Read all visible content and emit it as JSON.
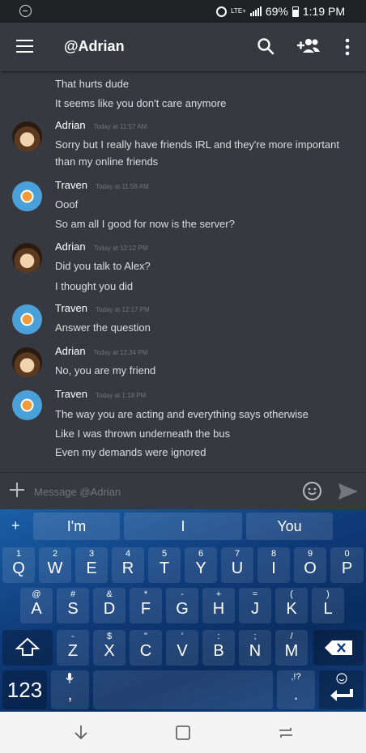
{
  "status_bar": {
    "network": "LTE+",
    "battery": "69%",
    "time": "1:19 PM"
  },
  "app_bar": {
    "title": "@Adrian",
    "icons": [
      "menu-icon",
      "search-icon",
      "add-friend-icon",
      "more-icon"
    ]
  },
  "messages": {
    "lines_top": [
      "That hurts dude",
      "It seems like you don't care anymore"
    ],
    "groups": [
      {
        "author": "Adrian",
        "timestamp": "Today at 11:57 AM",
        "lines": [
          "Sorry but I really have friends IRL and they're more important",
          "than my online friends"
        ]
      },
      {
        "author": "Traven",
        "timestamp": "Today at 11:58 AM",
        "lines": [
          "Ooof",
          "So am all I good for now is the server?"
        ]
      },
      {
        "author": "Adrian",
        "timestamp": "Today at 12:12 PM",
        "lines": [
          "Did you talk to Alex?",
          "I thought you did"
        ]
      },
      {
        "author": "Traven",
        "timestamp": "Today at 12:17 PM",
        "lines": [
          "Answer the question"
        ]
      },
      {
        "author": "Adrian",
        "timestamp": "Today at 12:34 PM",
        "lines": [
          "No, you are my friend"
        ]
      },
      {
        "author": "Traven",
        "timestamp": "Today at 1:18 PM",
        "lines": [
          "The way you are acting and everything says otherwise",
          "Like I was thrown underneath the bus",
          "Even my demands were ignored"
        ]
      }
    ]
  },
  "composer": {
    "placeholder": "Message @Adrian"
  },
  "keyboard": {
    "suggestions": [
      "I'm",
      "I",
      "You"
    ],
    "plus": "+",
    "row1": [
      {
        "main": "Q",
        "sub": "1"
      },
      {
        "main": "W",
        "sub": "2"
      },
      {
        "main": "E",
        "sub": "3"
      },
      {
        "main": "R",
        "sub": "4"
      },
      {
        "main": "T",
        "sub": "5"
      },
      {
        "main": "Y",
        "sub": "6"
      },
      {
        "main": "U",
        "sub": "7"
      },
      {
        "main": "I",
        "sub": "8"
      },
      {
        "main": "O",
        "sub": "9"
      },
      {
        "main": "P",
        "sub": "0"
      }
    ],
    "row2": [
      {
        "main": "A",
        "sub": "@"
      },
      {
        "main": "S",
        "sub": "#"
      },
      {
        "main": "D",
        "sub": "&"
      },
      {
        "main": "F",
        "sub": "*"
      },
      {
        "main": "G",
        "sub": "-"
      },
      {
        "main": "H",
        "sub": "+"
      },
      {
        "main": "J",
        "sub": "="
      },
      {
        "main": "K",
        "sub": "("
      },
      {
        "main": "L",
        "sub": ")"
      }
    ],
    "row3": [
      {
        "main": "Z",
        "sub": "-"
      },
      {
        "main": "X",
        "sub": "$"
      },
      {
        "main": "C",
        "sub": "\""
      },
      {
        "main": "V",
        "sub": "'"
      },
      {
        "main": "B",
        "sub": ":"
      },
      {
        "main": "N",
        "sub": ";"
      },
      {
        "main": "M",
        "sub": "/"
      }
    ],
    "num_key": "123",
    "comma_key": ",",
    "period_key": ".",
    "punct_sub": ",!?"
  }
}
